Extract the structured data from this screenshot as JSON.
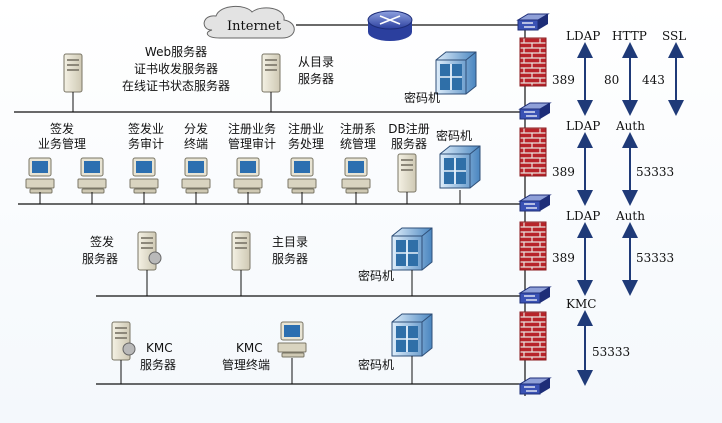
{
  "internet": {
    "label": "Internet"
  },
  "zone1": {
    "web_server": [
      "Web服务器",
      "证书收发服务器",
      "在线证书状态服务器"
    ],
    "slave_dir": [
      "从目录",
      "服务器"
    ],
    "crypto": "密码机"
  },
  "zone2": {
    "terminals": [
      [
        "签发",
        "业务管理"
      ],
      [
        "签发业",
        "务审计"
      ],
      [
        "分发",
        "终端"
      ],
      [
        "注册业务",
        "管理审计"
      ],
      [
        "注册业",
        "务处理"
      ],
      [
        "注册系",
        "统管理"
      ],
      [
        "DB注册",
        "服务器"
      ]
    ],
    "crypto": "密码机"
  },
  "zone3": {
    "sign_server": [
      "签发",
      "服务器"
    ],
    "master_dir": [
      "主目录",
      "服务器"
    ],
    "crypto": "密码机"
  },
  "zone4": {
    "kmc_server": [
      "KMC",
      "服务器"
    ],
    "kmc_terminal": [
      "KMC",
      "管理终端"
    ],
    "crypto": "密码机"
  },
  "ports": {
    "fw1": "389",
    "fw2": "389",
    "fw3": "389",
    "row1": {
      "ldap": "LDAP",
      "http": "HTTP",
      "ssl": "SSL",
      "p80": "80",
      "p443": "443"
    },
    "row2": {
      "ldap": "LDAP",
      "auth": "Auth",
      "p53333": "53333"
    },
    "row3": {
      "ldap": "LDAP",
      "auth": "Auth",
      "p53333": "53333"
    },
    "row4": {
      "kmc": "KMC",
      "p53333": "53333"
    }
  },
  "colors": {
    "firewall_brick": "#c0282d",
    "arrow": "#1f3a78",
    "line": "#111111",
    "crypto_blue": "#2f6fa8"
  }
}
